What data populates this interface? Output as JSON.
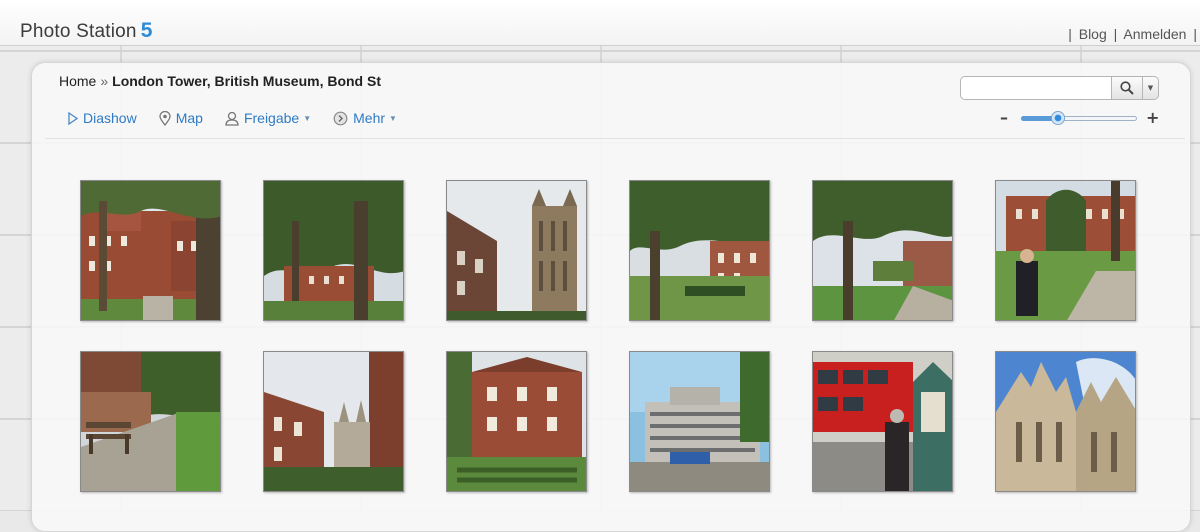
{
  "app": {
    "logo_text": "Photo Station",
    "logo_version": "5"
  },
  "top_links": {
    "blog": "Blog",
    "login": "Anmelden"
  },
  "breadcrumb": {
    "home": "Home",
    "separator": "»",
    "current": "London Tower, British Museum, Bond St"
  },
  "toolbar": {
    "slideshow": "Diashow",
    "map": "Map",
    "share": "Freigabe",
    "more": "Mehr"
  },
  "search": {
    "value": "",
    "placeholder": ""
  },
  "zoom": {
    "minus": "–",
    "plus": "+",
    "level": 0.32
  },
  "colors": {
    "accent": "#2e7bc4",
    "logo_version": "#2e8bd6"
  },
  "photos": [
    {
      "scene": "brick-college-courtyard-tree"
    },
    {
      "scene": "trees-over-brick-buildings"
    },
    {
      "scene": "gothic-tower-low-angle"
    },
    {
      "scene": "tree-garden-brick-houses"
    },
    {
      "scene": "tree-lawn-garden"
    },
    {
      "scene": "man-on-lawn-brick-buildings"
    },
    {
      "scene": "garden-bench-path"
    },
    {
      "scene": "brick-house-gothic-spires"
    },
    {
      "scene": "brick-house-hedge-garden"
    },
    {
      "scene": "modern-concrete-building"
    },
    {
      "scene": "red-bus-street-kiosk"
    },
    {
      "scene": "abbey-towers-blue-sky"
    }
  ]
}
